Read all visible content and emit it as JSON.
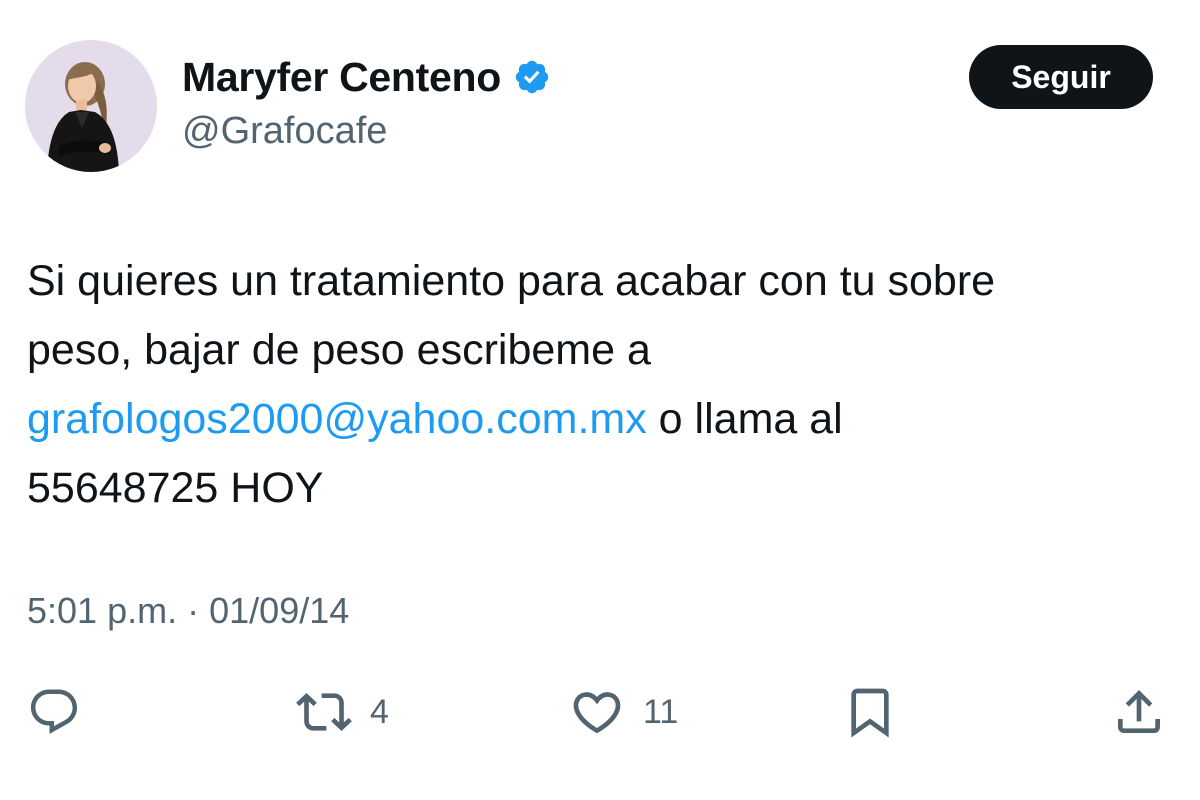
{
  "user": {
    "display_name": "Maryfer Centeno",
    "handle": "@Grafocafe",
    "verified": true,
    "avatar": "profile-photo"
  },
  "follow_button": {
    "label": "Seguir"
  },
  "tweet": {
    "line1": "Si quieres un tratamiento para acabar con tu sobre",
    "line2": "peso, bajar de peso escribeme a",
    "email": "grafologos2000@yahoo.com.mx",
    "line3_rest": " o llama al",
    "line4": "55648725 HOY"
  },
  "meta": {
    "time": "5:01 p.m.",
    "separator": "·",
    "date": "01/09/14"
  },
  "actions": {
    "reply": {
      "icon": "reply-icon"
    },
    "retweet": {
      "icon": "retweet-icon",
      "count": "4"
    },
    "like": {
      "icon": "heart-icon",
      "count": "11"
    },
    "bookmark": {
      "icon": "bookmark-icon"
    },
    "share": {
      "icon": "share-icon"
    }
  },
  "colors": {
    "link": "#1d9bf0",
    "text": "#0f1419",
    "secondary": "#536471",
    "verified_badge": "#1d9bf0",
    "button_bg": "#0f1419"
  }
}
